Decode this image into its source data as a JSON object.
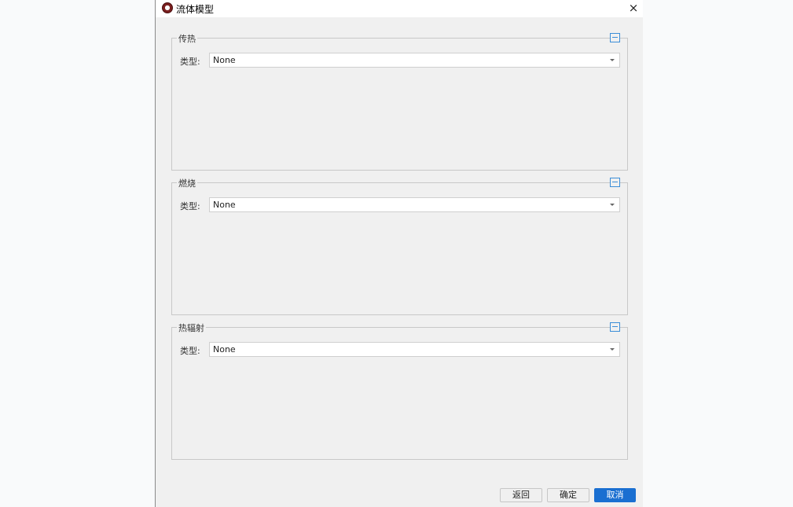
{
  "window": {
    "title": "流体模型",
    "close_label": "×"
  },
  "groups": [
    {
      "title": "传热",
      "field_label": "类型:",
      "selected": "None"
    },
    {
      "title": "燃烧",
      "field_label": "类型:",
      "selected": "None"
    },
    {
      "title": "热辐射",
      "field_label": "类型:",
      "selected": "None"
    }
  ],
  "buttons": {
    "back": "返回",
    "confirm": "确定",
    "cancel": "取消"
  },
  "colors": {
    "accent": "#1a6fd1",
    "collapse": "#3c8ed8",
    "dialog_bg": "#f0f0f0"
  },
  "icons": {
    "app": "app-logo-icon",
    "close": "close-icon",
    "collapse": "collapse-icon",
    "dropdown": "chevron-down-icon"
  }
}
